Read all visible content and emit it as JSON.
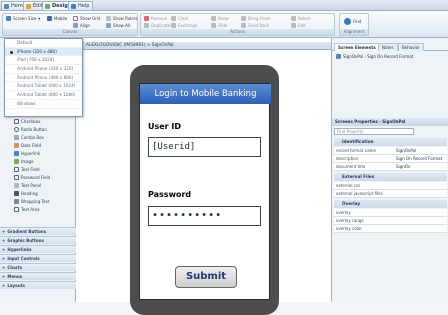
{
  "tabs": [
    "Home",
    "Edit",
    "Design",
    "Help"
  ],
  "ribbon": {
    "groups": [
      "Canvas",
      "Actions",
      "Alignment"
    ],
    "canvas": {
      "screen_size": "Screen Size",
      "mobile": "Mobile",
      "show_grid": "Show Grid",
      "show_rulers": "Show Rulers",
      "align": "Align",
      "show_all": "Show All",
      "snap": "Snap"
    },
    "actions": {
      "remove": "Remove",
      "clear": "Clear",
      "duplicate": "Duplicate",
      "exchange": "Exchange",
      "bring_front": "Bring Front",
      "send_back": "Send Back",
      "show": "Show",
      "hide": "Hide",
      "select": "Select",
      "edit": "Edit"
    },
    "alignment": {
      "find": "Find"
    }
  },
  "screen_size_menu": {
    "items": [
      "Default",
      "iPhone (320 x 480)",
      "iPad (768 x 1024)",
      "Android Phone (240 x 320)",
      "Android Phone (480 x 800)",
      "Android Tablet (600 x 1024)",
      "Android Tablet (800 x 1280)",
      "Windows"
    ],
    "selected": 1
  },
  "toolbox": {
    "items": [
      "Checkbox",
      "Radio Button",
      "Combo Box",
      "Date Field",
      "Hyperlink",
      "Image",
      "Text Field",
      "Password Field",
      "Text Panel",
      "Heading",
      "Wrapping Text",
      "Text Area"
    ],
    "categories": [
      "Gradient Buttons",
      "Graphic Buttons",
      "Hyperlinks",
      "Input Controls",
      "Charts",
      "Menus",
      "Layouts"
    ]
  },
  "canvas": {
    "breadcrumb": "ALEXLOGOUSSIC (IM58981) > SignOnPal",
    "app_title": "Login to Mobile Banking",
    "user_label": "User ID",
    "user_value": "[Userid]",
    "pw_label": "Password",
    "pw_value": "••••••••••",
    "submit": "Submit"
  },
  "right": {
    "tabs": [
      "Screen Elements",
      "Notes",
      "Behavior"
    ],
    "tree": "SignOnPal - Sign On Record Format",
    "props_title": "Screens Properties - SignOnPal",
    "search_placeholder": "Find Property",
    "sections": [
      "Identification",
      "External Files",
      "Overlay"
    ],
    "props": [
      {
        "name": "record format name",
        "value": "SignOnPal"
      },
      {
        "name": "description",
        "value": "Sign On Record Format"
      },
      {
        "name": "document title",
        "value": "SignOn"
      },
      {
        "name": "external css",
        "value": ""
      },
      {
        "name": "external javascript files",
        "value": ""
      },
      {
        "name": "overlay",
        "value": ""
      },
      {
        "name": "overlay range",
        "value": ""
      },
      {
        "name": "overlay color",
        "value": ""
      }
    ]
  }
}
